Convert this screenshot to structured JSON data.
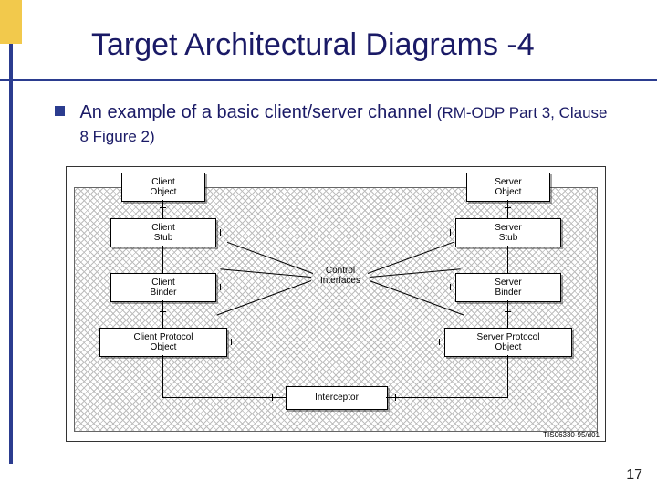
{
  "title": "Target Architectural Diagrams -4",
  "bullet": {
    "main": "An example of a basic client/server channel ",
    "sub": "(RM-ODP Part 3, Clause 8 Figure 2)"
  },
  "diagram": {
    "boxes": {
      "client_object": "Client\nObject",
      "client_stub": "Client\nStub",
      "client_binder": "Client\nBinder",
      "client_protocol": "Client Protocol\nObject",
      "server_object": "Server\nObject",
      "server_stub": "Server\nStub",
      "server_binder": "Server\nBinder",
      "server_protocol": "Server Protocol\nObject",
      "interceptor": "Interceptor"
    },
    "center_label": "Control\nInterfaces",
    "figure_code": "TIS06330-95/d01"
  },
  "page_number": "17"
}
